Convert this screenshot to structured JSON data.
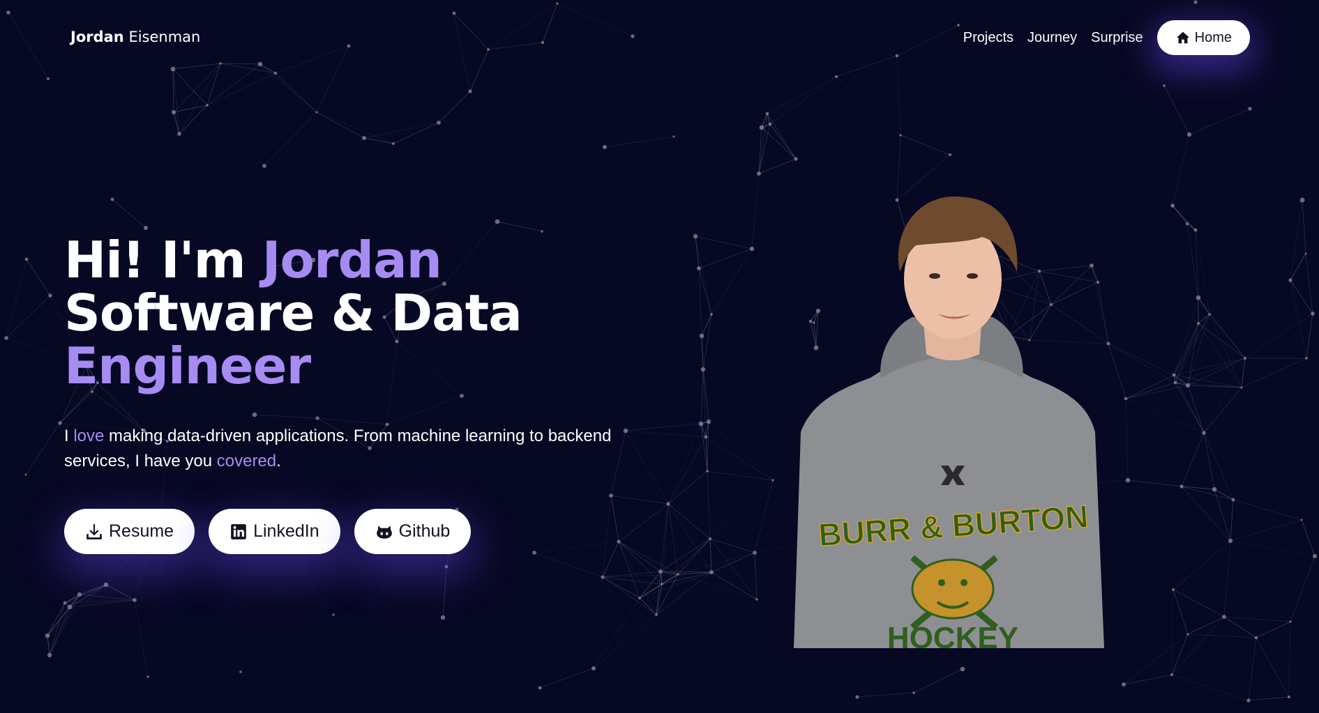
{
  "brand": {
    "first": "Jordan",
    "last": "Eisenman"
  },
  "nav": {
    "links": [
      "Projects",
      "Journey",
      "Surprise"
    ],
    "home_label": "Home"
  },
  "hero": {
    "line1_prefix": "Hi! I'm ",
    "line1_name": "Jordan",
    "line2": "Software & Data",
    "line3": "Engineer",
    "desc_1": "I ",
    "desc_love": "love",
    "desc_2": " making data-driven applications. From machine learning to backend services, I have you ",
    "desc_covered": "covered",
    "desc_3": "."
  },
  "actions": {
    "resume": "Resume",
    "linkedin": "LinkedIn",
    "github": "Github"
  },
  "portrait": {
    "shirt_brand": "BURR & BURTON",
    "shirt_sport": "HOCKEY"
  },
  "colors": {
    "background": "#070823",
    "accent": "#a68cf2",
    "network_line": "#8a8aa8",
    "hoodie": "#8e8f92",
    "shirt_text": "#2f5e1f",
    "shirt_trim": "#d6a42a"
  },
  "icons": {
    "home": "home-icon",
    "resume": "download-icon",
    "linkedin": "linkedin-icon",
    "github": "github-icon"
  }
}
